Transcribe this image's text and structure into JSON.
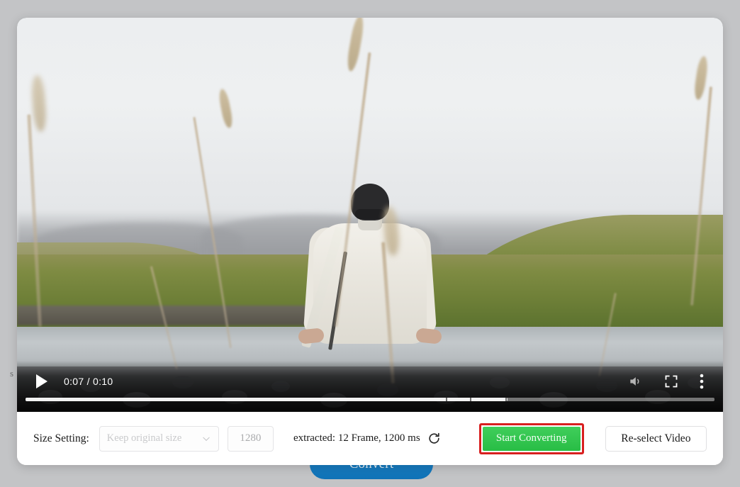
{
  "background": {
    "convert_button_label": "Convert",
    "left_edge_fragment": "s"
  },
  "video_player": {
    "play_icon": "play-icon",
    "time_display": "0:07 / 0:10",
    "current_time": "0:07",
    "duration": "0:10",
    "progress_percent": 70,
    "volume_icon": "volume-icon",
    "fullscreen_icon": "fullscreen-icon",
    "more_options_icon": "more-vertical-icon",
    "scene_description": "Person in white shirt and black beanie sitting on a rocky riverbank facing green hills"
  },
  "settings_bar": {
    "size_setting_label": "Size Setting:",
    "size_select_placeholder": "Keep original size",
    "size_select_value": "",
    "chevron_icon": "chevron-down-icon",
    "width_value": "1280",
    "extracted_info": "extracted: 12 Frame, 1200 ms",
    "refresh_icon": "refresh-icon",
    "start_button_label": "Start Converting",
    "reselect_button_label": "Re-select Video",
    "highlight_color": "#d81f1f",
    "start_button_color": "#2fc44d"
  }
}
